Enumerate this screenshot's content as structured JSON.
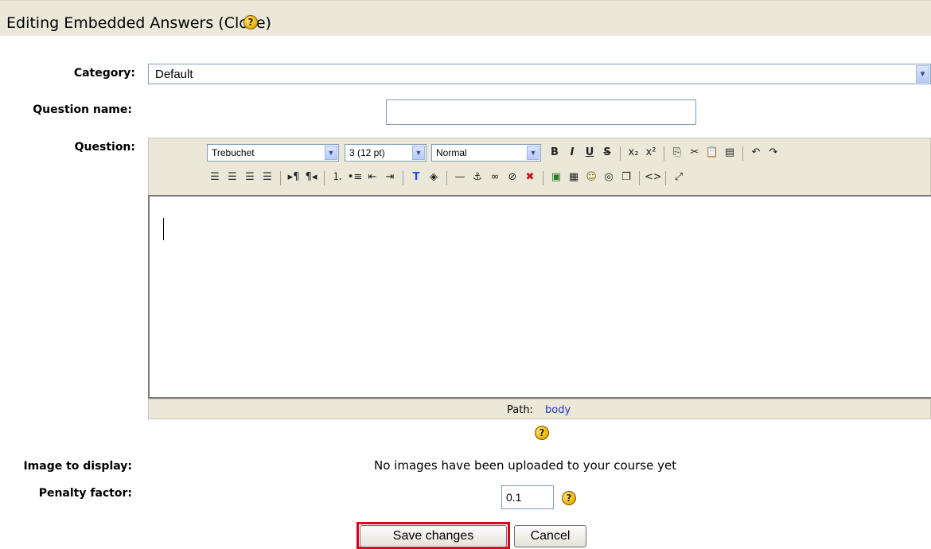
{
  "header": {
    "title": "Editing Embedded Answers (Cloze)",
    "help_glyph": "?"
  },
  "form": {
    "category_label": "Category:",
    "category_value": "Default",
    "question_name_label": "Question name:",
    "question_name_value": "",
    "question_label": "Question:",
    "image_label": "Image to display:",
    "image_text": "No images have been uploaded to your course yet",
    "penalty_label": "Penalty factor:",
    "penalty_value": "0.1"
  },
  "editor": {
    "font_family": "Trebuchet",
    "font_size": "3 (12 pt)",
    "paragraph": "Normal",
    "path_label": "Path:",
    "path_value": "body",
    "toolbar_row1": [
      {
        "name": "bold-icon",
        "glyph": "B"
      },
      {
        "name": "italic-icon",
        "glyph": "I"
      },
      {
        "name": "underline-icon",
        "glyph": "U"
      },
      {
        "name": "strikethrough-icon",
        "glyph": "S"
      },
      {
        "name": "sep"
      },
      {
        "name": "subscript-icon",
        "glyph": "x₂"
      },
      {
        "name": "superscript-icon",
        "glyph": "x²"
      },
      {
        "name": "sep"
      },
      {
        "name": "copy-icon",
        "glyph": "⎘"
      },
      {
        "name": "cut-icon",
        "glyph": "✂"
      },
      {
        "name": "paste-icon",
        "glyph": "📋"
      },
      {
        "name": "paste-word-icon",
        "glyph": "▤"
      },
      {
        "name": "sep"
      },
      {
        "name": "undo-icon",
        "glyph": "↶"
      },
      {
        "name": "redo-icon",
        "glyph": "↷"
      }
    ],
    "toolbar_row2": [
      {
        "name": "align-left-icon",
        "glyph": "☰"
      },
      {
        "name": "align-center-icon",
        "glyph": "☰"
      },
      {
        "name": "align-right-icon",
        "glyph": "☰"
      },
      {
        "name": "justify-icon",
        "glyph": "☰"
      },
      {
        "name": "sep"
      },
      {
        "name": "ltr-icon",
        "glyph": "▸¶"
      },
      {
        "name": "rtl-icon",
        "glyph": "¶◂"
      },
      {
        "name": "sep"
      },
      {
        "name": "ordered-list-icon",
        "glyph": "⒈"
      },
      {
        "name": "unordered-list-icon",
        "glyph": "•≡"
      },
      {
        "name": "outdent-icon",
        "glyph": "⇤"
      },
      {
        "name": "indent-icon",
        "glyph": "⇥"
      },
      {
        "name": "sep"
      },
      {
        "name": "text-color-icon",
        "glyph": "T"
      },
      {
        "name": "background-color-icon",
        "glyph": "◈"
      },
      {
        "name": "sep"
      },
      {
        "name": "horizontal-rule-icon",
        "glyph": "—"
      },
      {
        "name": "anchor-icon",
        "glyph": "⚓"
      },
      {
        "name": "link-icon",
        "glyph": "∞"
      },
      {
        "name": "unlink-icon",
        "glyph": "⊘"
      },
      {
        "name": "nolink-icon",
        "glyph": "✖"
      },
      {
        "name": "sep"
      },
      {
        "name": "insert-image-icon",
        "glyph": "▣"
      },
      {
        "name": "insert-table-icon",
        "glyph": "▦"
      },
      {
        "name": "smiley-icon",
        "glyph": "☺"
      },
      {
        "name": "special-char-icon",
        "glyph": "◎"
      },
      {
        "name": "search-replace-icon",
        "glyph": "❐"
      },
      {
        "name": "sep"
      },
      {
        "name": "html-source-icon",
        "glyph": "<>"
      },
      {
        "name": "sep"
      },
      {
        "name": "fullscreen-icon",
        "glyph": "⤢"
      }
    ]
  },
  "buttons": {
    "save": "Save changes",
    "cancel": "Cancel"
  }
}
